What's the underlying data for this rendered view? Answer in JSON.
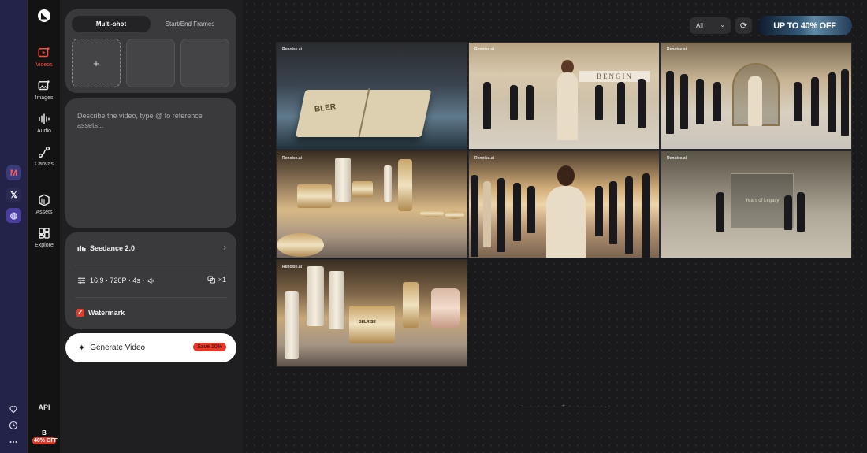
{
  "system_bar": {
    "apps": [
      {
        "name": "M",
        "icon": "gmail-icon"
      },
      {
        "name": "𝕏",
        "icon": "x-icon"
      },
      {
        "name": "◍",
        "icon": "headset-icon"
      }
    ],
    "bottom_icons": [
      "heart-icon",
      "clock-icon",
      "more-icon"
    ]
  },
  "rail": {
    "logo": "◣",
    "items": [
      {
        "label": "Videos",
        "icon": "video-icon",
        "active": true
      },
      {
        "label": "Images",
        "icon": "image-icon",
        "active": false
      },
      {
        "label": "Audio",
        "icon": "audio-icon",
        "active": false
      },
      {
        "label": "Canvas",
        "icon": "canvas-icon",
        "active": false
      },
      {
        "label": "Assets",
        "icon": "assets-icon",
        "active": false
      },
      {
        "label": "Explore",
        "icon": "explore-icon",
        "active": false
      }
    ],
    "api_label": "API",
    "avatar_initial": "B",
    "avatar_badge": "40% OFF"
  },
  "panel": {
    "tabs": [
      {
        "label": "Multi-shot",
        "active": true
      },
      {
        "label": "Start/End Frames",
        "active": false
      }
    ],
    "add_slot_label": "+",
    "prompt_placeholder": "Describe the video, type @ to reference assets...",
    "model": {
      "name": "Seedance 2.0",
      "chevron": "›"
    },
    "settings": {
      "summary": "16:9 · 720P · 4s ·",
      "duplicate_count": "×1"
    },
    "watermark": {
      "label": "Watermark",
      "checked": true,
      "mark": "✓"
    },
    "generate": {
      "label": "Generate Video",
      "badge": "Save 10%",
      "spark": "✦"
    }
  },
  "toolbar": {
    "filter_value": "All",
    "filter_caret": "⌄",
    "refresh_glyph": "⟳",
    "promo": "UP TO 40% OFF"
  },
  "gallery": {
    "watermark_text": "Renoise.ai",
    "banner_text": "BENGIN",
    "book_text": "BLER",
    "sign_text": "Years of Legacy",
    "jar_text": "BELRISE"
  },
  "colors": {
    "accent": "#e23a2a",
    "panel_bg": "#1f1f21",
    "card_bg": "#3a3a3d",
    "canvas_bg": "#1a1a1c",
    "system_bar": "#23234a"
  }
}
